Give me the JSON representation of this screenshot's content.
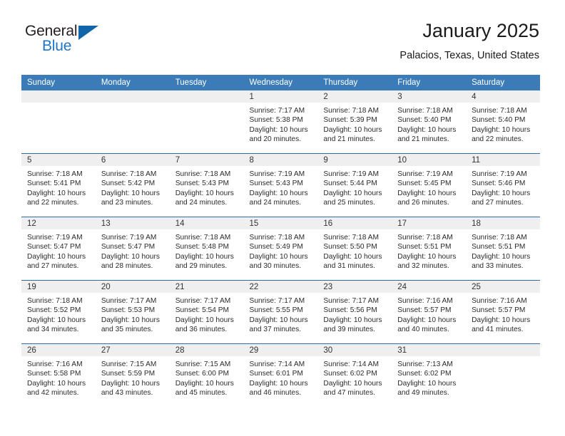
{
  "brand": {
    "name_top": "General",
    "name_bottom": "Blue",
    "triangle_color": "#1066a8",
    "blue": "#2176c7"
  },
  "header": {
    "title": "January 2025",
    "subtitle": "Palacios, Texas, United States"
  },
  "theme": {
    "header_bg": "#3b7cb8",
    "row_divider": "#2d6ca8",
    "daynum_band": "#efefef",
    "page_bg": "#ffffff"
  },
  "calendar": {
    "weekday_headers": [
      "Sunday",
      "Monday",
      "Tuesday",
      "Wednesday",
      "Thursday",
      "Friday",
      "Saturday"
    ],
    "labels": {
      "sunrise": "Sunrise:",
      "sunset": "Sunset:",
      "daylight": "Daylight:"
    },
    "weeks": [
      [
        {
          "day": "",
          "empty": true
        },
        {
          "day": "",
          "empty": true
        },
        {
          "day": "",
          "empty": true
        },
        {
          "day": "1",
          "sunrise": "Sunrise: 7:17 AM",
          "sunset": "Sunset: 5:38 PM",
          "daylight": "Daylight: 10 hours and 20 minutes."
        },
        {
          "day": "2",
          "sunrise": "Sunrise: 7:18 AM",
          "sunset": "Sunset: 5:39 PM",
          "daylight": "Daylight: 10 hours and 21 minutes."
        },
        {
          "day": "3",
          "sunrise": "Sunrise: 7:18 AM",
          "sunset": "Sunset: 5:40 PM",
          "daylight": "Daylight: 10 hours and 21 minutes."
        },
        {
          "day": "4",
          "sunrise": "Sunrise: 7:18 AM",
          "sunset": "Sunset: 5:40 PM",
          "daylight": "Daylight: 10 hours and 22 minutes."
        }
      ],
      [
        {
          "day": "5",
          "sunrise": "Sunrise: 7:18 AM",
          "sunset": "Sunset: 5:41 PM",
          "daylight": "Daylight: 10 hours and 22 minutes."
        },
        {
          "day": "6",
          "sunrise": "Sunrise: 7:18 AM",
          "sunset": "Sunset: 5:42 PM",
          "daylight": "Daylight: 10 hours and 23 minutes."
        },
        {
          "day": "7",
          "sunrise": "Sunrise: 7:18 AM",
          "sunset": "Sunset: 5:43 PM",
          "daylight": "Daylight: 10 hours and 24 minutes."
        },
        {
          "day": "8",
          "sunrise": "Sunrise: 7:19 AM",
          "sunset": "Sunset: 5:43 PM",
          "daylight": "Daylight: 10 hours and 24 minutes."
        },
        {
          "day": "9",
          "sunrise": "Sunrise: 7:19 AM",
          "sunset": "Sunset: 5:44 PM",
          "daylight": "Daylight: 10 hours and 25 minutes."
        },
        {
          "day": "10",
          "sunrise": "Sunrise: 7:19 AM",
          "sunset": "Sunset: 5:45 PM",
          "daylight": "Daylight: 10 hours and 26 minutes."
        },
        {
          "day": "11",
          "sunrise": "Sunrise: 7:19 AM",
          "sunset": "Sunset: 5:46 PM",
          "daylight": "Daylight: 10 hours and 27 minutes."
        }
      ],
      [
        {
          "day": "12",
          "sunrise": "Sunrise: 7:19 AM",
          "sunset": "Sunset: 5:47 PM",
          "daylight": "Daylight: 10 hours and 27 minutes."
        },
        {
          "day": "13",
          "sunrise": "Sunrise: 7:19 AM",
          "sunset": "Sunset: 5:47 PM",
          "daylight": "Daylight: 10 hours and 28 minutes."
        },
        {
          "day": "14",
          "sunrise": "Sunrise: 7:18 AM",
          "sunset": "Sunset: 5:48 PM",
          "daylight": "Daylight: 10 hours and 29 minutes."
        },
        {
          "day": "15",
          "sunrise": "Sunrise: 7:18 AM",
          "sunset": "Sunset: 5:49 PM",
          "daylight": "Daylight: 10 hours and 30 minutes."
        },
        {
          "day": "16",
          "sunrise": "Sunrise: 7:18 AM",
          "sunset": "Sunset: 5:50 PM",
          "daylight": "Daylight: 10 hours and 31 minutes."
        },
        {
          "day": "17",
          "sunrise": "Sunrise: 7:18 AM",
          "sunset": "Sunset: 5:51 PM",
          "daylight": "Daylight: 10 hours and 32 minutes."
        },
        {
          "day": "18",
          "sunrise": "Sunrise: 7:18 AM",
          "sunset": "Sunset: 5:51 PM",
          "daylight": "Daylight: 10 hours and 33 minutes."
        }
      ],
      [
        {
          "day": "19",
          "sunrise": "Sunrise: 7:18 AM",
          "sunset": "Sunset: 5:52 PM",
          "daylight": "Daylight: 10 hours and 34 minutes."
        },
        {
          "day": "20",
          "sunrise": "Sunrise: 7:17 AM",
          "sunset": "Sunset: 5:53 PM",
          "daylight": "Daylight: 10 hours and 35 minutes."
        },
        {
          "day": "21",
          "sunrise": "Sunrise: 7:17 AM",
          "sunset": "Sunset: 5:54 PM",
          "daylight": "Daylight: 10 hours and 36 minutes."
        },
        {
          "day": "22",
          "sunrise": "Sunrise: 7:17 AM",
          "sunset": "Sunset: 5:55 PM",
          "daylight": "Daylight: 10 hours and 37 minutes."
        },
        {
          "day": "23",
          "sunrise": "Sunrise: 7:17 AM",
          "sunset": "Sunset: 5:56 PM",
          "daylight": "Daylight: 10 hours and 39 minutes."
        },
        {
          "day": "24",
          "sunrise": "Sunrise: 7:16 AM",
          "sunset": "Sunset: 5:57 PM",
          "daylight": "Daylight: 10 hours and 40 minutes."
        },
        {
          "day": "25",
          "sunrise": "Sunrise: 7:16 AM",
          "sunset": "Sunset: 5:57 PM",
          "daylight": "Daylight: 10 hours and 41 minutes."
        }
      ],
      [
        {
          "day": "26",
          "sunrise": "Sunrise: 7:16 AM",
          "sunset": "Sunset: 5:58 PM",
          "daylight": "Daylight: 10 hours and 42 minutes."
        },
        {
          "day": "27",
          "sunrise": "Sunrise: 7:15 AM",
          "sunset": "Sunset: 5:59 PM",
          "daylight": "Daylight: 10 hours and 43 minutes."
        },
        {
          "day": "28",
          "sunrise": "Sunrise: 7:15 AM",
          "sunset": "Sunset: 6:00 PM",
          "daylight": "Daylight: 10 hours and 45 minutes."
        },
        {
          "day": "29",
          "sunrise": "Sunrise: 7:14 AM",
          "sunset": "Sunset: 6:01 PM",
          "daylight": "Daylight: 10 hours and 46 minutes."
        },
        {
          "day": "30",
          "sunrise": "Sunrise: 7:14 AM",
          "sunset": "Sunset: 6:02 PM",
          "daylight": "Daylight: 10 hours and 47 minutes."
        },
        {
          "day": "31",
          "sunrise": "Sunrise: 7:13 AM",
          "sunset": "Sunset: 6:02 PM",
          "daylight": "Daylight: 10 hours and 49 minutes."
        },
        {
          "day": "",
          "empty": true
        }
      ]
    ]
  }
}
